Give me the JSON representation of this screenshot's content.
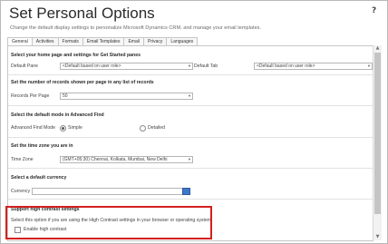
{
  "header": {
    "title": "Set Personal Options",
    "subtitle": "Change the default display settings to personalize Microsoft Dynamics CRM, and manage your email templates.",
    "help_label": "?"
  },
  "tabs": [
    "General",
    "Activities",
    "Formats",
    "Email Templates",
    "Email",
    "Privacy",
    "Languages"
  ],
  "active_tab": "General",
  "sections": {
    "home_pane": {
      "heading": "Select your home page and settings for Get Started panes",
      "default_pane_label": "Default Pane",
      "default_pane_value": "<Default based on user role>",
      "default_tab_label": "Default Tab",
      "default_tab_value": "<Default based on user role>"
    },
    "records": {
      "heading": "Set the number of records shown per page in any list of records",
      "label": "Records Per Page",
      "value": "50"
    },
    "advanced_find": {
      "heading": "Select the default mode in Advanced Find",
      "label": "Advanced Find Mode",
      "option_simple": "Simple",
      "option_detailed": "Detailed",
      "selected": "Simple"
    },
    "time_zone": {
      "heading": "Set the time zone you are in",
      "label": "Time Zone",
      "value": "(GMT+05:30) Chennai, Kolkata, Mumbai, New Delhi"
    },
    "currency": {
      "heading": "Select a default currency",
      "label": "Currency",
      "value": ""
    },
    "high_contrast": {
      "heading": "Support high contrast settings",
      "description": "Select this option if you are using the High Contrast settings in your browser or operating system.",
      "checkbox_label": "Enable high contrast",
      "checked": false
    }
  },
  "colors": {
    "highlight_border": "#d32020",
    "lookup_icon": "#3f78c9"
  }
}
